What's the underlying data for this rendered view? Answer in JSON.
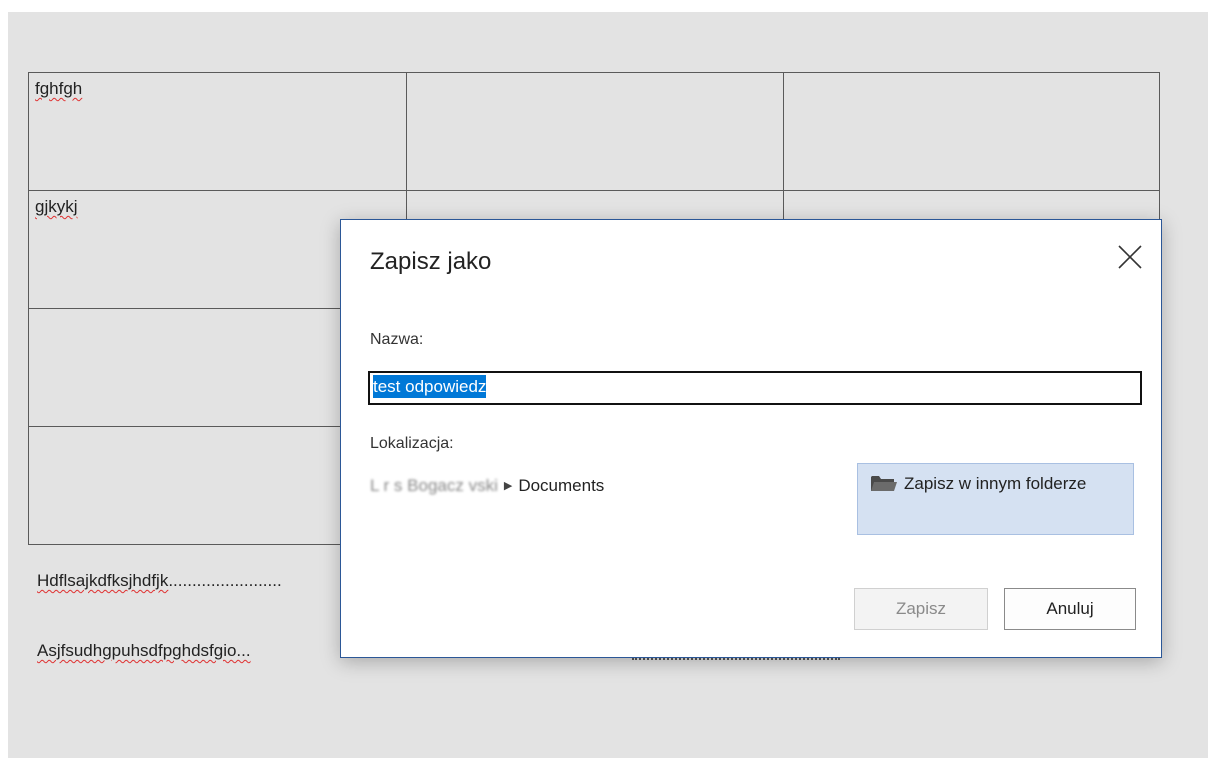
{
  "document": {
    "table": [
      [
        "fghfgh",
        "",
        ""
      ],
      [
        "gjkykj",
        "",
        ""
      ],
      [
        "",
        "",
        ""
      ],
      [
        "",
        "",
        ""
      ]
    ],
    "line1": "Hdflsajkdfksjhdfjk",
    "line1_dots": "........................",
    "line2": "Asjfsudhgpuhsdfpghdsfgio..."
  },
  "dialog": {
    "title": "Zapisz jako",
    "name_label": "Nazwa:",
    "name_value": "test odpowiedz",
    "location_label": "Lokalizacja:",
    "location_blurred": "L    r s      Bogacz   vski",
    "location_folder": "Documents",
    "other_folder_label": "Zapisz w innym folderze",
    "save_label": "Zapisz",
    "cancel_label": "Anuluj",
    "icons": {
      "close": "close-icon",
      "folder": "folder-icon",
      "path_separator": "chevron-right-icon"
    }
  },
  "colors": {
    "selection": "#0078d7",
    "dialog_border": "#2b5797",
    "other_folder_bg": "#d5e1f2",
    "spellcheck": "#e03030"
  }
}
